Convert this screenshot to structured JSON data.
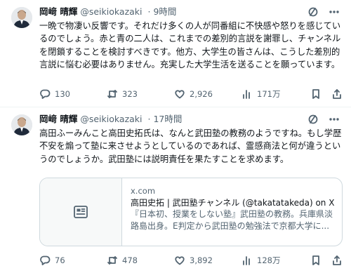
{
  "tweets": [
    {
      "name": "岡﨑 晴輝",
      "handle": "@seikiokazaki",
      "time": "· 9時間",
      "text": "一晩で物凄い反響です。それだけ多くの人が同番組に不快感や怒りを感じているのでしょう。赤と青の二人は、これまでの差別的言説を謝罪し、チャンネルを閉鎖することを検討すべきです。他方、大学生の皆さんは、こうした差別的言説に悩む必要はありません。充実した大学生活を送ることを願っています。",
      "replies": "130",
      "retweets": "323",
      "likes": "2,926",
      "views": "171万"
    },
    {
      "name": "岡﨑 晴輝",
      "handle": "@seikiokazaki",
      "time": "· 17時間",
      "text": "高田ふーみんこと高田史拓氏は、なんと武田塾の教務のようですね。もし学歴不安を煽って塾に来させようとしているのであれば、霊感商法と何が違うというのでしょうか。武田塾には説明責任を果たすことを求めます。",
      "card": {
        "domain": "x.com",
        "title": "高田史拓 | 武田塾チャンネル (@takatatakeda) on X",
        "description": "『日本初、授業をしない塾』武田塾の教務。兵庫県淡路島出身。E判定から武田塾の勉強法で京都大学に..."
      },
      "replies": "76",
      "retweets": "478",
      "likes": "3,892",
      "views": "128万"
    }
  ],
  "icons": {
    "grok": "grok-icon",
    "more": "more-icon",
    "reply": "reply-icon",
    "retweet": "retweet-icon",
    "like": "heart-icon",
    "views": "views-icon",
    "bookmark": "bookmark-icon",
    "share": "share-icon",
    "card_thumb": "article-icon"
  },
  "colors": {
    "text": "#0f1419",
    "secondary": "#536471",
    "border": "#cfd9de"
  }
}
